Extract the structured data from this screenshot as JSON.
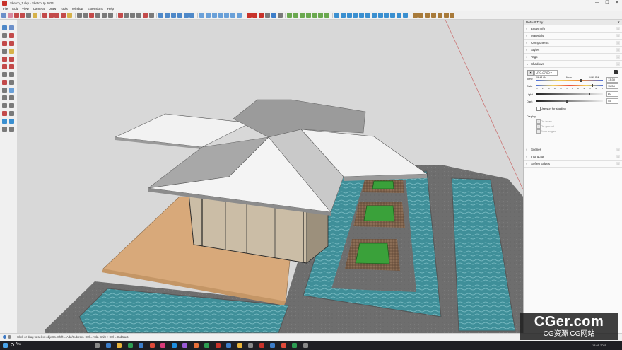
{
  "window": {
    "title": "Sketch_1.skp - SketchUp 2024",
    "minimize": "—",
    "maximize": "☐",
    "close": "✕"
  },
  "menu": [
    "File",
    "Edit",
    "View",
    "Camera",
    "Draw",
    "Tools",
    "Window",
    "Extensions",
    "Help"
  ],
  "tray": {
    "title": "Default Tray",
    "close": "✕",
    "panels_top": [
      "Entity Info",
      "Materials",
      "Components",
      "Styles",
      "Tags"
    ],
    "shadows": {
      "title": "Shadows",
      "timezone": "UTC-07:00",
      "time_label": "Time",
      "time_start": "06:43 AM",
      "time_mid": "Noon",
      "time_end": "04:45 PM",
      "time_value": "13:30",
      "date_label": "Date",
      "date_value": "11/08",
      "months": [
        "J",
        "F",
        "M",
        "A",
        "M",
        "J",
        "J",
        "A",
        "S",
        "O",
        "N",
        "D"
      ],
      "light_label": "Light",
      "light_value": "80",
      "dark_label": "Dark",
      "dark_value": "45",
      "use_sun": "Use sun for shading",
      "display_label": "Display:",
      "on_faces": "On faces",
      "on_ground": "On ground",
      "from_edges": "From edges"
    },
    "panels_bottom": [
      "Scenes",
      "Instructor",
      "Soften Edges"
    ]
  },
  "status": {
    "hint": "Click or drag to select objects. Shift = Add/Subtract. Ctrl = Add. Shift + Ctrl = Subtract."
  },
  "taskbar": {
    "search": "Ara",
    "clock": "18.05.2025"
  },
  "watermark": {
    "big": "CGer.com",
    "small": "CG资源 CG网站"
  },
  "colors": {
    "sketchup_red": "#c8322a",
    "water": "#3f8f99",
    "deck": "#d8a97a",
    "grass": "#3aa13a",
    "stone": "#6b6b6b"
  }
}
